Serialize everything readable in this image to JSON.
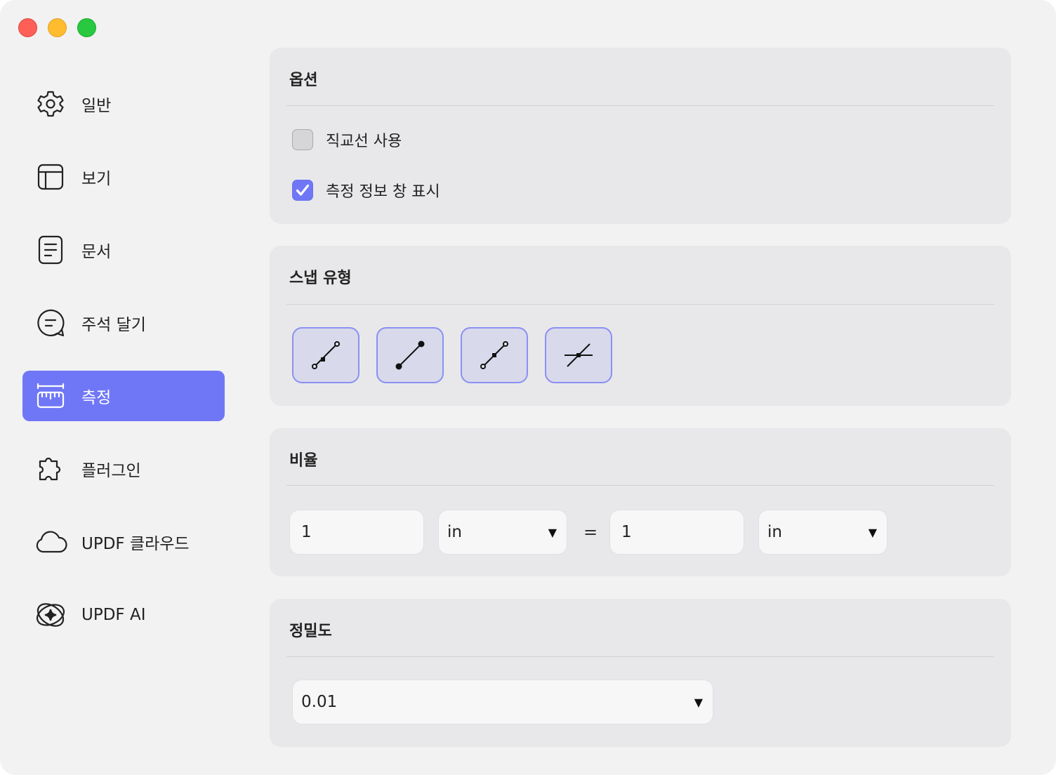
{
  "window": {
    "controls": [
      "close",
      "minimize",
      "maximize"
    ]
  },
  "sidebar": {
    "items": [
      {
        "label": "일반",
        "icon": "gear-icon",
        "active": false
      },
      {
        "label": "보기",
        "icon": "layout-icon",
        "active": false
      },
      {
        "label": "문서",
        "icon": "document-icon",
        "active": false
      },
      {
        "label": "주석 달기",
        "icon": "comment-icon",
        "active": false
      },
      {
        "label": "측정",
        "icon": "ruler-icon",
        "active": true
      },
      {
        "label": "플러그인",
        "icon": "puzzle-icon",
        "active": false
      },
      {
        "label": "UPDF 클라우드",
        "icon": "cloud-icon",
        "active": false
      },
      {
        "label": "UPDF AI",
        "icon": "ai-sparkle-icon",
        "active": false
      }
    ]
  },
  "options": {
    "title": "옵션",
    "items": [
      {
        "label": "직교선 사용",
        "checked": false
      },
      {
        "label": "측정 정보 창 표시",
        "checked": true
      }
    ]
  },
  "snap": {
    "title": "스냅 유형",
    "buttons": [
      "snap-to-endpoint-icon",
      "snap-to-path-icon",
      "snap-to-midpoint-icon",
      "snap-to-intersection-icon"
    ]
  },
  "ratio": {
    "title": "비율",
    "left_value": "1",
    "left_unit": "in",
    "equals": "=",
    "right_value": "1",
    "right_unit": "in"
  },
  "precision": {
    "title": "정밀도",
    "value": "0.01"
  },
  "colors": {
    "accent": "#7077f6",
    "card": "#e8e8ea",
    "window": "#f2f2f2"
  }
}
